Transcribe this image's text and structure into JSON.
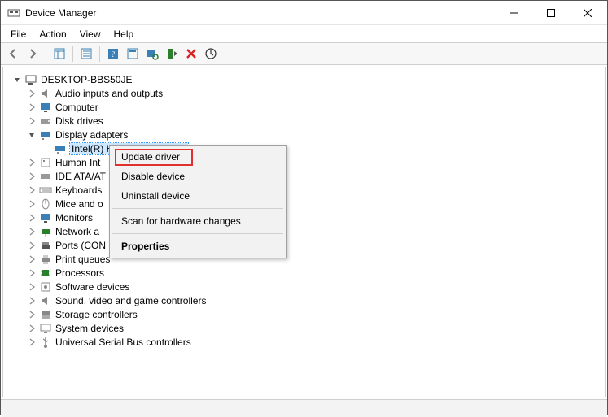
{
  "window": {
    "title": "Device Manager"
  },
  "menubar": {
    "file": "File",
    "action": "Action",
    "view": "View",
    "help": "Help"
  },
  "tree": {
    "root": "DESKTOP-BBS50JE",
    "audio": "Audio inputs and outputs",
    "computer": "Computer",
    "disk": "Disk drives",
    "display": "Display adapters",
    "display_child": "Intel(R) HD Graphics 4600",
    "hid": "Human Int",
    "ide": "IDE ATA/AT",
    "keyboards": "Keyboards",
    "mice": "Mice and o",
    "monitors": "Monitors",
    "network": "Network a",
    "ports": "Ports (CON",
    "printqueues": "Print queues",
    "processors": "Processors",
    "software": "Software devices",
    "sound": "Sound, video and game controllers",
    "storage": "Storage controllers",
    "system": "System devices",
    "usb": "Universal Serial Bus controllers"
  },
  "context_menu": {
    "update": "Update driver",
    "disable": "Disable device",
    "uninstall": "Uninstall device",
    "scan": "Scan for hardware changes",
    "properties": "Properties"
  }
}
